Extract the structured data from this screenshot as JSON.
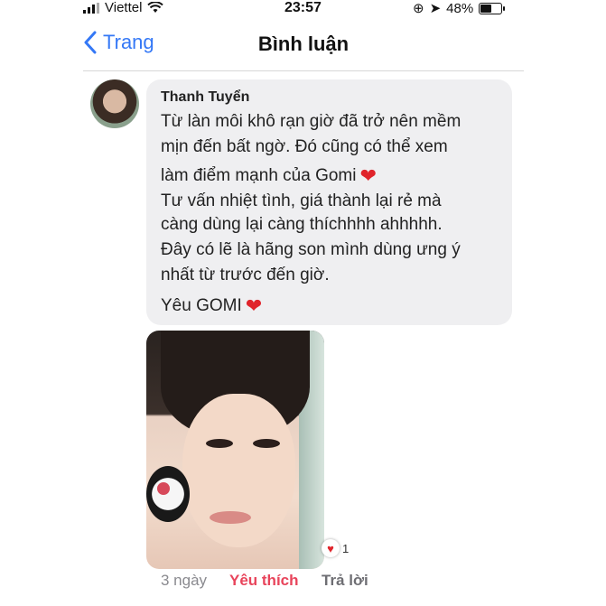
{
  "status_bar": {
    "carrier": "Viettel",
    "time": "23:57",
    "battery": "48%"
  },
  "nav": {
    "back_label": "Trang",
    "title": "Bình luận"
  },
  "comment": {
    "author": "Thanh Tuyển",
    "lines": [
      "Từ làn môi khô rạn giờ đã trở nên mềm",
      "mịn đến bất ngờ. Đó cũng có thể xem",
      "làm điểm mạnh của Gomi",
      "Tư vấn nhiệt tình, giá thành lại rẻ mà",
      "càng dùng lại càng thíchhhh ahhhhh.",
      "Đây có lẽ là hãng son mình dùng ưng ý",
      "nhất từ trước đến giờ.",
      "Yêu GOMI"
    ],
    "heart": "❤",
    "reaction_count": "1",
    "meta": {
      "age": "3 ngày",
      "like_label": "Yêu thích",
      "reply_label": "Trả lời"
    }
  },
  "colors": {
    "accent": "#3478f6",
    "like": "#e8445b",
    "heart": "#e0242b"
  },
  "icons": {
    "back": "chevron-left-icon",
    "wifi": "wifi-icon",
    "battery": "battery-icon",
    "reaction": "heart-icon"
  }
}
